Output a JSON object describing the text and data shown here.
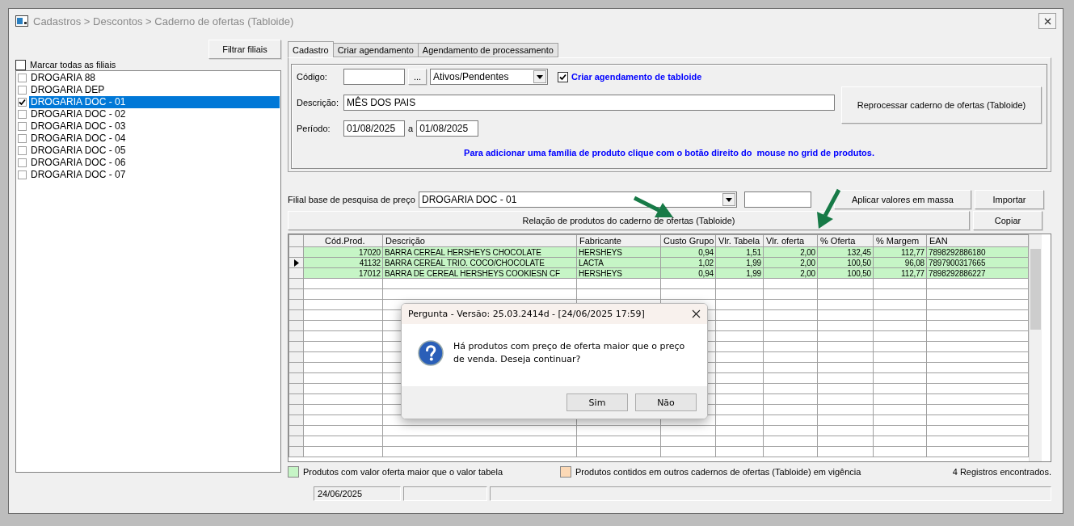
{
  "window": {
    "title": "Cadastros > Descontos > Caderno de ofertas (Tabloide)"
  },
  "branches": {
    "filter_button": "Filtrar filiais",
    "select_all": {
      "label": "Marcar todas as filiais",
      "checked": false
    },
    "items": [
      {
        "label": "DROGARIA 88",
        "checked": false,
        "selected": false
      },
      {
        "label": "DROGARIA DEP",
        "checked": false,
        "selected": false
      },
      {
        "label": "DROGARIA DOC - 01",
        "checked": true,
        "selected": true
      },
      {
        "label": "DROGARIA DOC - 02",
        "checked": false,
        "selected": false
      },
      {
        "label": "DROGARIA DOC - 03",
        "checked": false,
        "selected": false
      },
      {
        "label": "DROGARIA DOC - 04",
        "checked": false,
        "selected": false
      },
      {
        "label": "DROGARIA DOC - 05",
        "checked": false,
        "selected": false
      },
      {
        "label": "DROGARIA DOC - 06",
        "checked": false,
        "selected": false
      },
      {
        "label": "DROGARIA DOC - 07",
        "checked": false,
        "selected": false
      }
    ]
  },
  "tabs": [
    {
      "label": "Cadastro",
      "selected": true
    },
    {
      "label": "Criar agendamento",
      "selected": false
    },
    {
      "label": "Agendamento de processamento",
      "selected": false
    }
  ],
  "form": {
    "code_label": "Código:",
    "lookup_button": "...",
    "status": "Ativos/Pendentes",
    "schedule": {
      "label": "Criar agendamento de tabloide",
      "checked": true
    },
    "description_label": "Descrição:",
    "description": "MÊS DOS PAIS",
    "period_label": "Período:",
    "start": "01/08/2025",
    "between": "a",
    "end": "01/08/2025",
    "reprocess_button": "Reprocessar caderno de ofertas (Tabloide)",
    "hint": "Para adicionar uma família de produto clique com o botão direito do  mouse no grid de produtos."
  },
  "price_base": {
    "label": "Filial base de pesquisa de preço",
    "value": "DROGARIA DOC - 01"
  },
  "apply_button": "Aplicar valores em massa",
  "import_button": "Importar",
  "relation_button": "Relação de produtos do caderno de ofertas (Tabloide)",
  "copy_button": "Copiar",
  "grid": {
    "columns": [
      "Cód.Prod.",
      "Descrição",
      "Fabricante",
      "Custo Grupo",
      "Vlr. Tabela",
      "Vlr. oferta",
      "% Oferta",
      "% Margem",
      "EAN"
    ],
    "rows": [
      {
        "current": false,
        "color": "#c6f5c6",
        "cells": [
          "17020",
          "BARRA CEREAL HERSHEYS CHOCOLATE",
          "HERSHEYS",
          "0,94",
          "1,51",
          "2,00",
          "132,45",
          "112,77",
          "7898292886180"
        ]
      },
      {
        "current": true,
        "color": "#c6f5c6",
        "cells": [
          "41132",
          "BARRA CEREAL TRIO. COCO/CHOCOLATE",
          "LACTA",
          "1,02",
          "1,99",
          "2,00",
          "100,50",
          "96,08",
          "7897900317665"
        ]
      },
      {
        "current": false,
        "color": "#c6f5c6",
        "cells": [
          "17012",
          "BARRA DE CEREAL HERSHEYS COOKIESN CF",
          "HERSHEYS",
          "0,94",
          "1,99",
          "2,00",
          "100,50",
          "112,77",
          "7898292886227"
        ]
      }
    ]
  },
  "legend": [
    {
      "label": "Produtos com valor oferta maior que o valor tabela",
      "color": "#c6f5c6"
    },
    {
      "label": "Produtos contidos em outros cadernos de ofertas (Tabloide) em vigência",
      "color": "#fcd9b6"
    }
  ],
  "record_count": "4 Registros encontrados.",
  "status_bar": [
    "24/06/2025"
  ],
  "dialog": {
    "title": "Pergunta - Versão: 25.03.2414d - [24/06/2025 17:59]",
    "message": "Há produtos com preço de oferta maior que o preço de venda. Deseja continuar?",
    "buttons": [
      "Sim",
      "Não"
    ]
  }
}
